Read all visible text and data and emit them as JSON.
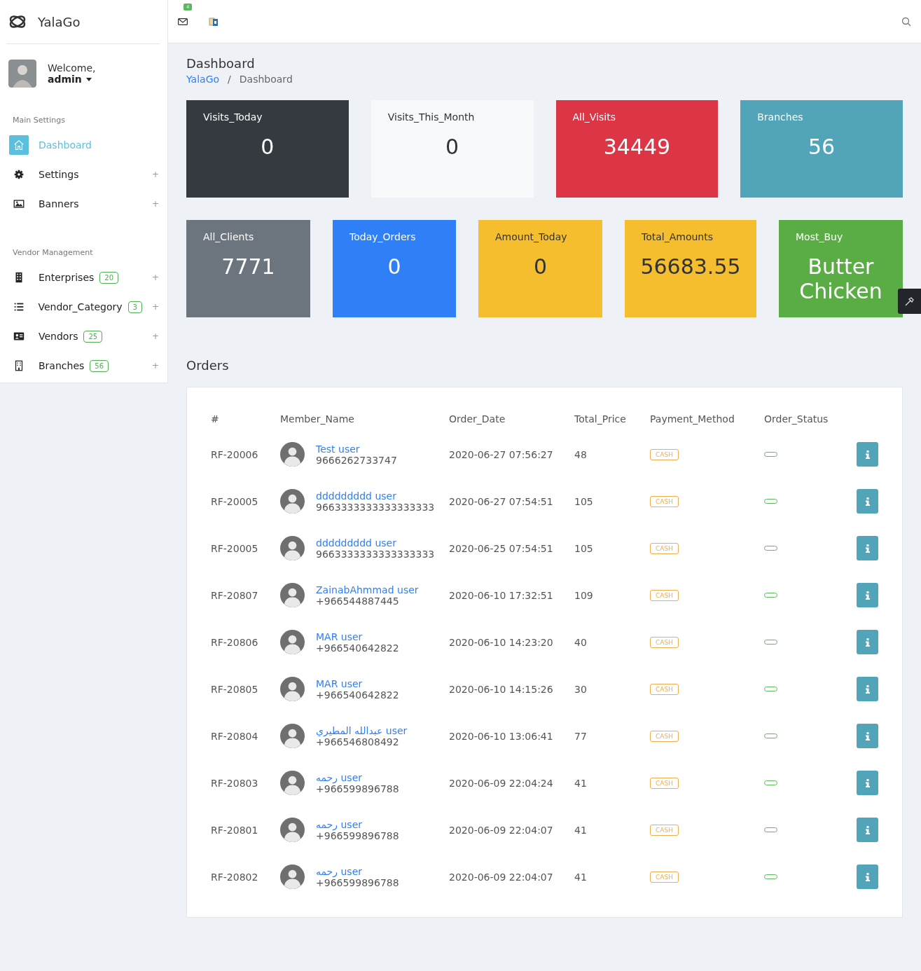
{
  "brand": {
    "name": "YalaGo"
  },
  "user": {
    "greeting": "Welcome,",
    "name": "admin"
  },
  "topbar": {
    "mail_badge": "4"
  },
  "sidebar": {
    "sections": [
      {
        "title": "Main Settings",
        "items": [
          {
            "label": "Dashboard",
            "selected": true
          },
          {
            "label": "Settings",
            "selected": false,
            "expand": "+"
          },
          {
            "label": "Banners",
            "selected": false,
            "expand": "+"
          }
        ]
      },
      {
        "title": "Vendor Management",
        "items": [
          {
            "label": "Enterprises",
            "selected": false,
            "count": "20",
            "expand": "+"
          },
          {
            "label": "Vendor_Category",
            "selected": false,
            "count": "3",
            "expand": "+"
          },
          {
            "label": "Vendors",
            "selected": false,
            "count": "25",
            "expand": "+"
          },
          {
            "label": "Branches",
            "selected": false,
            "count": "56",
            "expand": "+"
          }
        ]
      }
    ]
  },
  "page": {
    "title": "Dashboard",
    "breadcrumb_separator": "/",
    "breadcrumb": [
      {
        "label": "YalaGo",
        "link": true
      },
      {
        "label": "Dashboard",
        "link": false
      }
    ]
  },
  "stats_row_1": [
    {
      "label": "Visits_Today",
      "value": "0",
      "color": "#343a40"
    },
    {
      "label": "Visits_This_Month",
      "value": "0",
      "color": "#f8f9fa"
    },
    {
      "label": "All_Visits",
      "value": "34449",
      "color": "#dc3545"
    },
    {
      "label": "Branches",
      "value": "56",
      "color": "#52a4b9"
    }
  ],
  "stats_row_2": [
    {
      "label": "All_Clients",
      "value": "7771",
      "color": "#6c757d"
    },
    {
      "label": "Today_Orders",
      "value": "0",
      "color": "#2f7ff7"
    },
    {
      "label": "Amount_Today",
      "value": "0",
      "color": "#f4be2e"
    },
    {
      "label": "Total_Amounts",
      "value": "56683.55",
      "color": "#f4be2e"
    },
    {
      "label": "Most_Buy",
      "value": "Butter Chicken",
      "color": "#5aad45"
    }
  ],
  "orders": {
    "title": "Orders",
    "columns": [
      "#",
      "Member_Name",
      "Order_Date",
      "Total_Price",
      "Payment_Method",
      "Order_Status"
    ],
    "rows": [
      {
        "id": "RF-20006",
        "name": "Test user",
        "phone": "9666262733747",
        "date": "2020-06-27 07:56:27",
        "price": "48",
        "payment": "CASH"
      },
      {
        "id": "RF-20005",
        "name": "ddddddddd user",
        "phone": "9663333333333333333",
        "date": "2020-06-27 07:54:51",
        "price": "105",
        "payment": "CASH"
      },
      {
        "id": "RF-20005",
        "name": "ddddddddd user",
        "phone": "9663333333333333333",
        "date": "2020-06-25 07:54:51",
        "price": "105",
        "payment": "CASH"
      },
      {
        "id": "RF-20807",
        "name": "ZainabAhmmad user",
        "phone": "+966544887445",
        "date": "2020-06-10 17:32:51",
        "price": "109",
        "payment": "CASH"
      },
      {
        "id": "RF-20806",
        "name": "MAR user",
        "phone": "+966540642822",
        "date": "2020-06-10 14:23:20",
        "price": "40",
        "payment": "CASH"
      },
      {
        "id": "RF-20805",
        "name": "MAR user",
        "phone": "+966540642822",
        "date": "2020-06-10 14:15:26",
        "price": "30",
        "payment": "CASH"
      },
      {
        "id": "RF-20804",
        "name": "عبدالله المطيري user",
        "phone": "+966546808492",
        "date": "2020-06-10 13:06:41",
        "price": "77",
        "payment": "CASH"
      },
      {
        "id": "RF-20803",
        "name": "رحمه user",
        "phone": "+966599896788",
        "date": "2020-06-09 22:04:24",
        "price": "41",
        "payment": "CASH"
      },
      {
        "id": "RF-20801",
        "name": "رحمه user",
        "phone": "+966599896788",
        "date": "2020-06-09 22:04:07",
        "price": "41",
        "payment": "CASH"
      },
      {
        "id": "RF-20802",
        "name": "رحمه user",
        "phone": "+966599896788",
        "date": "2020-06-09 22:04:07",
        "price": "41",
        "payment": "CASH"
      }
    ]
  }
}
